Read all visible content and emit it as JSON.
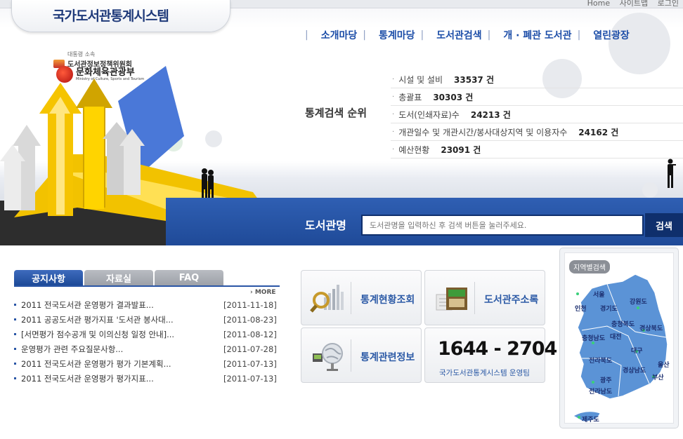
{
  "header": {
    "site_title": "국가도서관통계시스템",
    "util_links": [
      "Home",
      "사이트맵",
      "로그인"
    ]
  },
  "gnb": {
    "items": [
      "소개마당",
      "통계마당",
      "도서관검색",
      "개 · 폐관 도서관",
      "열린광장"
    ]
  },
  "orgs": {
    "committee_sub": "대통령 소속",
    "committee": "도서관정보정책위원회",
    "ministry": "문화체육관광부",
    "ministry_en": "Ministry of Culture, Sports and Tourism"
  },
  "ranking": {
    "title": "통계검색 순위",
    "unit": "건",
    "items": [
      {
        "label": "시설 및 설비",
        "count": "33537"
      },
      {
        "label": "총괄표",
        "count": "30303"
      },
      {
        "label": "도서(인쇄자료)수",
        "count": "24213"
      },
      {
        "label": "개관일수 및 개관시간/봉사대상지역 및 이용자수",
        "count": "24162"
      },
      {
        "label": "예산현황",
        "count": "23091"
      }
    ]
  },
  "search": {
    "label": "도서관명",
    "placeholder": "도서관명을 입력하신 후 검색 버튼을 눌러주세요.",
    "button": "검색"
  },
  "board": {
    "tabs": [
      "공지사항",
      "자료실",
      "FAQ"
    ],
    "more": "MORE",
    "items": [
      {
        "title": "2011 전국도서관 운영평가 결과발표...",
        "date": "[2011-11-18]"
      },
      {
        "title": "2011 공공도서관 평가지표 '도서관 봉사대...",
        "date": "[2011-08-23]"
      },
      {
        "title": "[서면평가 점수공개 및 이의신청 일정 안내]...",
        "date": "[2011-08-12]"
      },
      {
        "title": "운영평가 관련 주요질문사항...",
        "date": "[2011-07-28]"
      },
      {
        "title": "2011 전국도서관 운영평가 평가 기본계획...",
        "date": "[2011-07-13]"
      },
      {
        "title": "2011 전국도서관 운영평가 평가지표...",
        "date": "[2011-07-13]"
      }
    ]
  },
  "quick": {
    "stats_lookup": "통계현황조회",
    "address_book": "도서관주소록",
    "stats_info": "통계관련정보",
    "phone": "1644 - 2704",
    "phone_team": "국가도서관통계시스템 운영팀"
  },
  "map": {
    "tag": "지역별검색",
    "regions": [
      "서울",
      "인천",
      "경기도",
      "강원도",
      "충청북도",
      "충청남도",
      "대전",
      "경상북도",
      "대구",
      "전라북도",
      "울산",
      "광주",
      "경상남도",
      "부산",
      "전라남도",
      "제주도"
    ]
  },
  "colors": {
    "brand_blue": "#1d4ea8",
    "search_band": "#2f5fb3",
    "map_fill": "#5b93d6",
    "arrow_yellow": "#f7c400"
  }
}
